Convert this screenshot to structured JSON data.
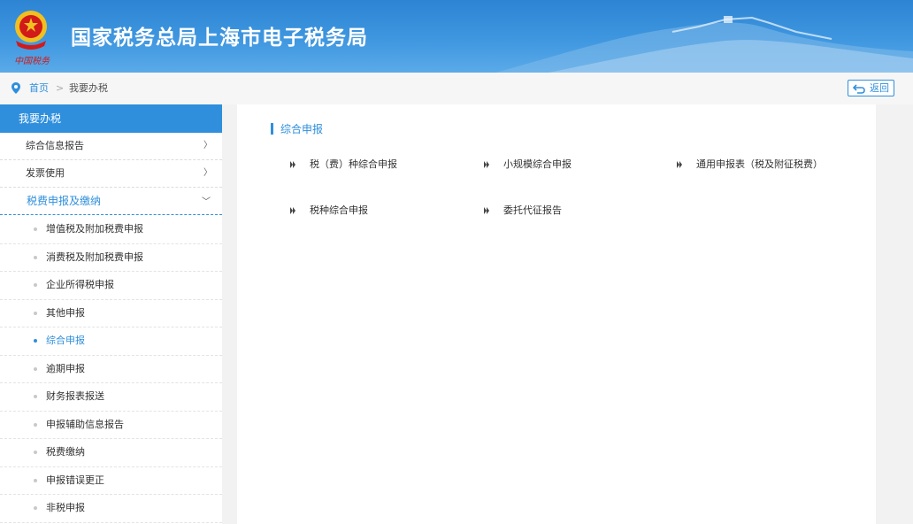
{
  "header": {
    "site_title": "国家税务总局上海市电子税务局",
    "signature": "中国税务"
  },
  "breadcrumb": {
    "home": "首页",
    "separator": ">",
    "current": "我要办税",
    "back_label": "返回"
  },
  "sidebar": {
    "title": "我要办税",
    "groups": [
      {
        "label": "综合信息报告",
        "chevron": "〉"
      },
      {
        "label": "发票使用",
        "chevron": "〉"
      },
      {
        "label": "税费申报及缴纳",
        "chevron": "﹀"
      }
    ],
    "sub_items": [
      {
        "label": "增值税及附加税费申报"
      },
      {
        "label": "消费税及附加税费申报"
      },
      {
        "label": "企业所得税申报"
      },
      {
        "label": "其他申报"
      },
      {
        "label": "综合申报",
        "active": true
      },
      {
        "label": "逾期申报"
      },
      {
        "label": "财务报表报送"
      },
      {
        "label": "申报辅助信息报告"
      },
      {
        "label": "税费缴纳"
      },
      {
        "label": "申报错误更正"
      },
      {
        "label": "非税申报"
      }
    ]
  },
  "content": {
    "section_title": "综合申报",
    "links": [
      {
        "label": "税（费）种综合申报"
      },
      {
        "label": "小规模综合申报"
      },
      {
        "label": "通用申报表（税及附征税费）"
      },
      {
        "label": "税种综合申报"
      },
      {
        "label": "委托代征报告"
      }
    ]
  },
  "colors": {
    "accent": "#2f8fdc",
    "header_blue": "#3f97e0",
    "emblem_red": "#d21a1a",
    "emblem_gold": "#f0c020"
  }
}
